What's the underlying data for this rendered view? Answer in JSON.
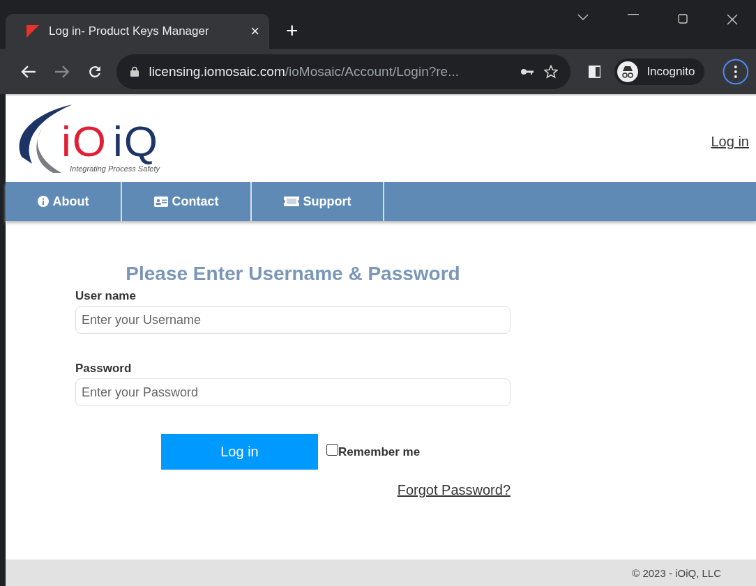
{
  "browser": {
    "tab_title": "Log in- Product Keys Manager",
    "tab_close": "×",
    "new_tab": "+",
    "url_host": "licensing.iomosaic.com",
    "url_path": "/ioMosaic/Account/Login?re...",
    "profile": "Incognito"
  },
  "logo": {
    "part_1": "iO",
    "part_2": "iQ",
    "tagline": "Integrating Process Safety"
  },
  "header_link": "Log in",
  "nav": [
    {
      "label": "About"
    },
    {
      "label": "Contact"
    },
    {
      "label": "Support"
    }
  ],
  "form": {
    "title": "Please Enter Username & Password",
    "fields": [
      {
        "label": "User name",
        "placeholder": "Enter your Username"
      },
      {
        "label": "Password",
        "placeholder": "Enter your Password"
      }
    ],
    "submit": "Log in",
    "remember": {
      "label": "Remember me",
      "checked": false
    },
    "forgot": "Forgot Password?"
  },
  "footer": "© 2023 - iOiQ, LLC"
}
